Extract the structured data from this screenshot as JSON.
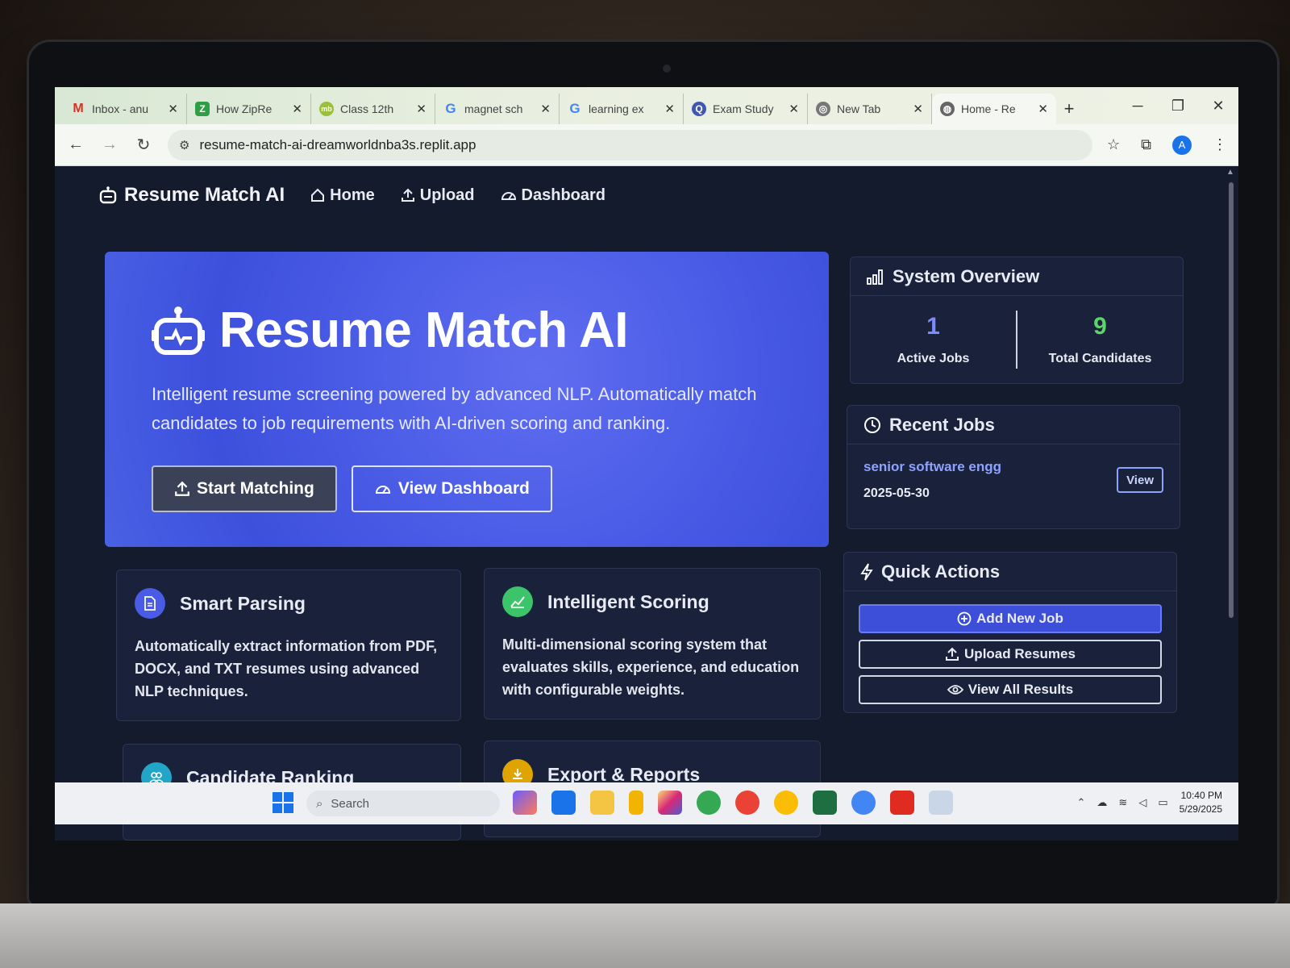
{
  "browser": {
    "tabs": [
      {
        "title": "Inbox - anu",
        "icon": "gmail-icon",
        "color": "#d93025"
      },
      {
        "title": "How ZipRe",
        "icon": "ziprecruiter-icon",
        "color": "#2f9e44"
      },
      {
        "title": "Class 12th",
        "icon": "mb-icon",
        "color": "#9bbf3a"
      },
      {
        "title": "magnet sch",
        "icon": "google-icon",
        "color": "#4285f4"
      },
      {
        "title": "learning ex",
        "icon": "google-icon",
        "color": "#4285f4"
      },
      {
        "title": "Exam Study",
        "icon": "quizlet-icon",
        "color": "#4257b2"
      },
      {
        "title": "New Tab",
        "icon": "chrome-icon",
        "color": "#777"
      },
      {
        "title": "Home - Re",
        "icon": "globe-icon",
        "color": "#666"
      }
    ],
    "new_tab": "+",
    "url": "resume-match-ai-dreamworldnba3s.replit.app",
    "profile_initial": "A"
  },
  "nav": {
    "brand": "Resume Match AI",
    "links": [
      "Home",
      "Upload",
      "Dashboard"
    ]
  },
  "hero": {
    "title": "Resume Match AI",
    "description": "Intelligent resume screening powered by advanced NLP. Automatically match candidates to job requirements with AI-driven scoring and ranking.",
    "primary_button": "Start Matching",
    "secondary_button": "View Dashboard"
  },
  "features": [
    {
      "title": "Smart Parsing",
      "description": "Automatically extract information from PDF, DOCX, and TXT resumes using advanced NLP techniques.",
      "color": "#4a5ce6"
    },
    {
      "title": "Intelligent Scoring",
      "description": "Multi-dimensional scoring system that evaluates skills, experience, and education with configurable weights.",
      "color": "#3cc46a"
    },
    {
      "title": "Candidate Ranking",
      "color": "#22a6c8"
    },
    {
      "title": "Export & Reports",
      "color": "#e0a400"
    }
  ],
  "overview": {
    "title": "System Overview",
    "active_jobs": "1",
    "active_jobs_label": "Active Jobs",
    "total_candidates": "9",
    "total_candidates_label": "Total Candidates",
    "active_color": "#7b8cff",
    "total_color": "#5bd46a"
  },
  "recent_jobs": {
    "title": "Recent Jobs",
    "items": [
      {
        "title": "senior software engg",
        "date": "2025-05-30",
        "action": "View"
      }
    ]
  },
  "quick_actions": {
    "title": "Quick Actions",
    "add_job": "Add New Job",
    "upload": "Upload Resumes",
    "view_results": "View All Results"
  },
  "taskbar": {
    "search_placeholder": "Search",
    "time": "10:40 PM",
    "date": "5/29/2025"
  }
}
